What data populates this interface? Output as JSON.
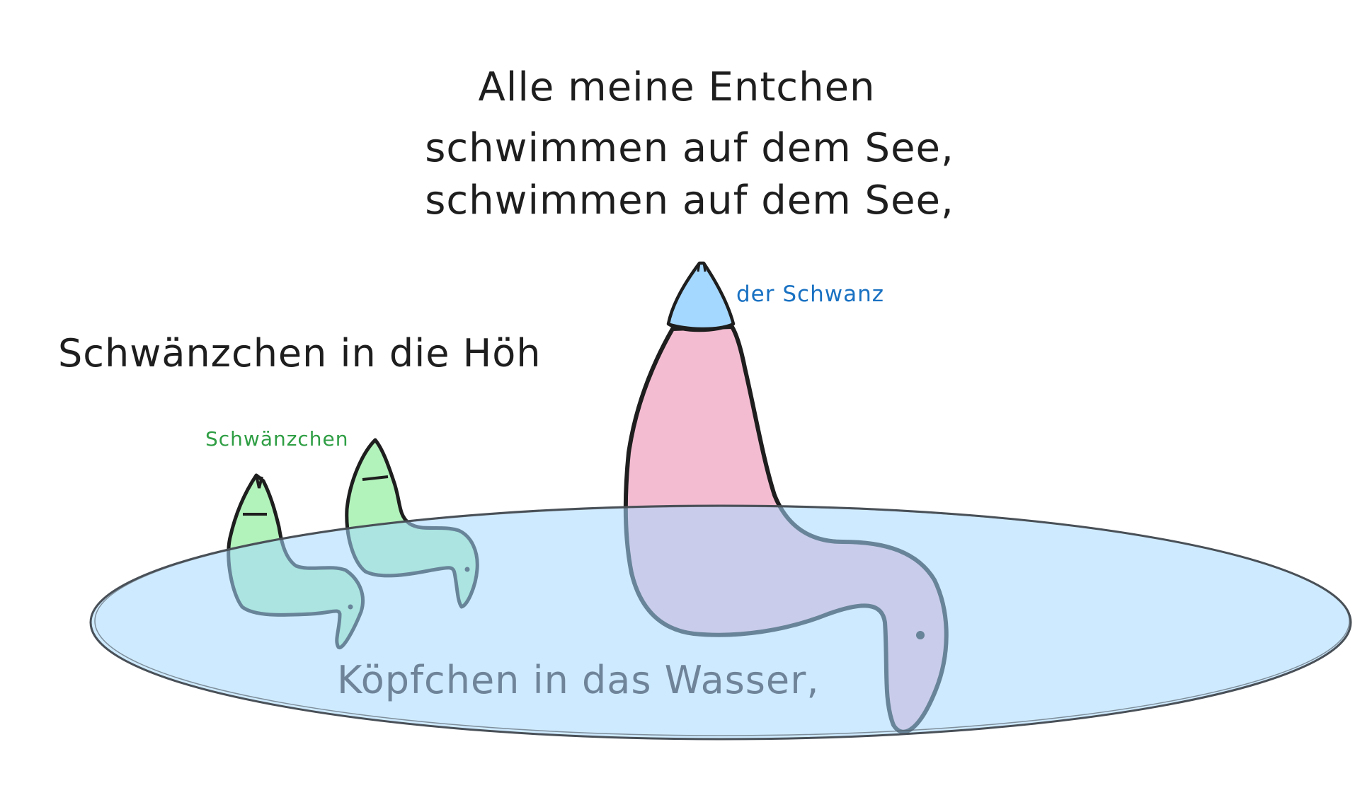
{
  "title_lines": [
    "Alle meine Entchen",
    "schwimmen auf dem See,",
    "schwimmen auf dem See,"
  ],
  "verse_tail": "Schwänzchen in die Höh",
  "verse_head": "Köpfchen in das Wasser,",
  "labels": {
    "small_tail": "Schwänzchen",
    "big_tail": "der Schwanz"
  },
  "colors": {
    "ink": "#1e1e1e",
    "lake_fill": "#a5d8ff",
    "lake_stroke": "#495057",
    "duck_small_fill": "#b2f2bb",
    "duck_big_fill": "#f3bcd1",
    "tail_tip_fill": "#a5d8ff",
    "label_green": "#2f9e44",
    "label_blue": "#1971c2"
  }
}
